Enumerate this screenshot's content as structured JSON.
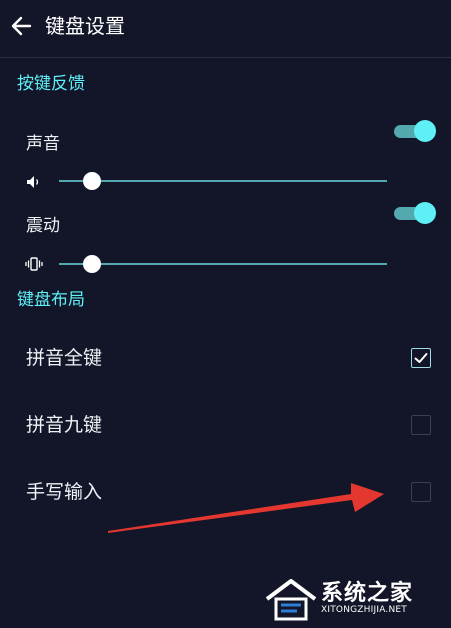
{
  "header": {
    "title": "键盘设置",
    "back_icon": "arrow-left-icon"
  },
  "colors": {
    "background": "#121628",
    "accent": "#5ef0f6",
    "track": "#54a9ae",
    "text": "#f0f1f6",
    "arrow": "#e3372f"
  },
  "sections": {
    "feedback": {
      "title": "按键反馈",
      "sound": {
        "label": "声音",
        "enabled": true,
        "icon": "volume-icon",
        "level": 0.1
      },
      "vibration": {
        "label": "震动",
        "enabled": true,
        "icon": "vibrate-icon",
        "level": 0.1
      }
    },
    "layout": {
      "title": "键盘布局",
      "options": [
        {
          "label": "拼音全键",
          "checked": true
        },
        {
          "label": "拼音九键",
          "checked": false
        },
        {
          "label": "手写输入",
          "checked": false
        }
      ]
    }
  },
  "watermark": {
    "text": "系统之家",
    "subtext": "XITONGZHIJIA.NET"
  }
}
